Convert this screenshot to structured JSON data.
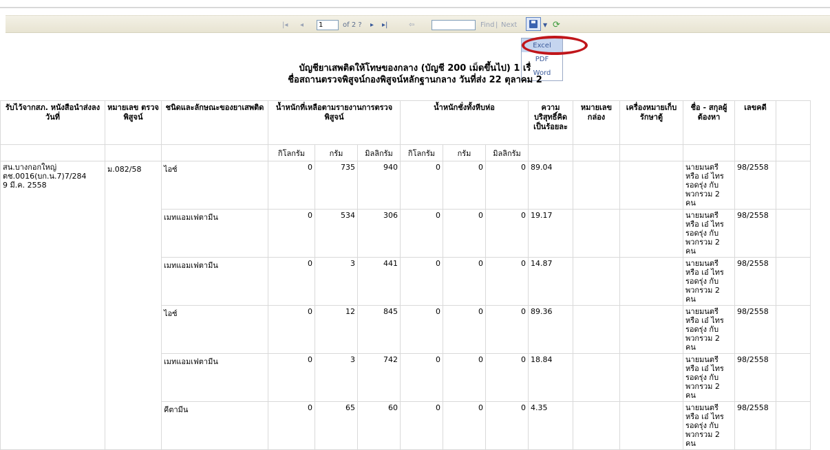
{
  "toolbar": {
    "page_current": "1",
    "page_total": "of 2 ?",
    "find_label": "Find",
    "separator": "|",
    "next_label": "Next",
    "export_menu": [
      "Excel",
      "PDF",
      "Word"
    ]
  },
  "report": {
    "title_line1": "บัญชียาเสพติดให้โทษของกลาง (บัญชี 200 เม็ดขึ้นไป) 1 เรื่",
    "title_line2": "ชื่อสถานตรวจพิสูจน์กองพิสูจน์หลักฐานกลาง วันที่ส่ง 22 ตุลาคม 2"
  },
  "table": {
    "headers": {
      "received": "รับไว้จากสภ. หนังสือนำส่งลงวันที่",
      "exam_no": "หมายเลข ตรวจพิสูจน์",
      "drug_type": "ชนิดและลักษณะของยาเสพติด",
      "remaining_weight": "น้ำหนักที่เหลือตามรายงานการตรวจพิสูจน์",
      "total_weight": "น้ำหนักชั่งทั้งหีบห่อ",
      "purity": "ความบริสุทธิ์คิดเป็นร้อยละ",
      "box_no": "หมายเลขกล่อง",
      "storage": "เครื่องหมายเก็บรักษาตู้",
      "suspect": "ชื่อ - สกุลผู้ต้องหา",
      "case_no": "เลขคดี",
      "kg": "กิโลกรัม",
      "g": "กรัม",
      "mg": "มิลลิกรัม"
    },
    "station": "สน.บางกอกใหญ่",
    "letter": "ตช.0016(บก.น.7)7/284",
    "date": "9 มี.ค. 2558",
    "exam_number": "ม.082/58",
    "rows": [
      {
        "drug": "ไอซ์",
        "kg1": "0",
        "g1": "735",
        "mg1": "940",
        "kg2": "0",
        "g2": "0",
        "mg2": "0",
        "purity": "89.04",
        "suspect": "นายมนตรี หรือ เอ๋ ไทรรอดรุ่ง กับ พวกรวม 2 คน",
        "case": "98/2558"
      },
      {
        "drug": "เมทแอมเฟตามีน",
        "kg1": "0",
        "g1": "534",
        "mg1": "306",
        "kg2": "0",
        "g2": "0",
        "mg2": "0",
        "purity": "19.17",
        "suspect": "นายมนตรี หรือ เอ๋ ไทรรอดรุ่ง กับ พวกรวม 2 คน",
        "case": "98/2558"
      },
      {
        "drug": "เมทแอมเฟตามีน",
        "kg1": "0",
        "g1": "3",
        "mg1": "441",
        "kg2": "0",
        "g2": "0",
        "mg2": "0",
        "purity": "14.87",
        "suspect": "นายมนตรี หรือ เอ๋ ไทรรอดรุ่ง กับ พวกรวม 2 คน",
        "case": "98/2558"
      },
      {
        "drug": "ไอซ์",
        "kg1": "0",
        "g1": "12",
        "mg1": "845",
        "kg2": "0",
        "g2": "0",
        "mg2": "0",
        "purity": "89.36",
        "suspect": "นายมนตรี หรือ เอ๋ ไทรรอดรุ่ง กับ พวกรวม 2 คน",
        "case": "98/2558"
      },
      {
        "drug": "เมทแอมเฟตามีน",
        "kg1": "0",
        "g1": "3",
        "mg1": "742",
        "kg2": "0",
        "g2": "0",
        "mg2": "0",
        "purity": "18.84",
        "suspect": "นายมนตรี หรือ เอ๋ ไทรรอดรุ่ง กับ พวกรวม 2 คน",
        "case": "98/2558"
      },
      {
        "drug": "คีตามีน",
        "kg1": "0",
        "g1": "65",
        "mg1": "60",
        "kg2": "0",
        "g2": "0",
        "mg2": "0",
        "purity": "4.35",
        "suspect": "นายมนตรี หรือ เอ๋ ไทรรอดรุ่ง กับ พวกรวม 2 คน",
        "case": "98/2558"
      }
    ]
  }
}
